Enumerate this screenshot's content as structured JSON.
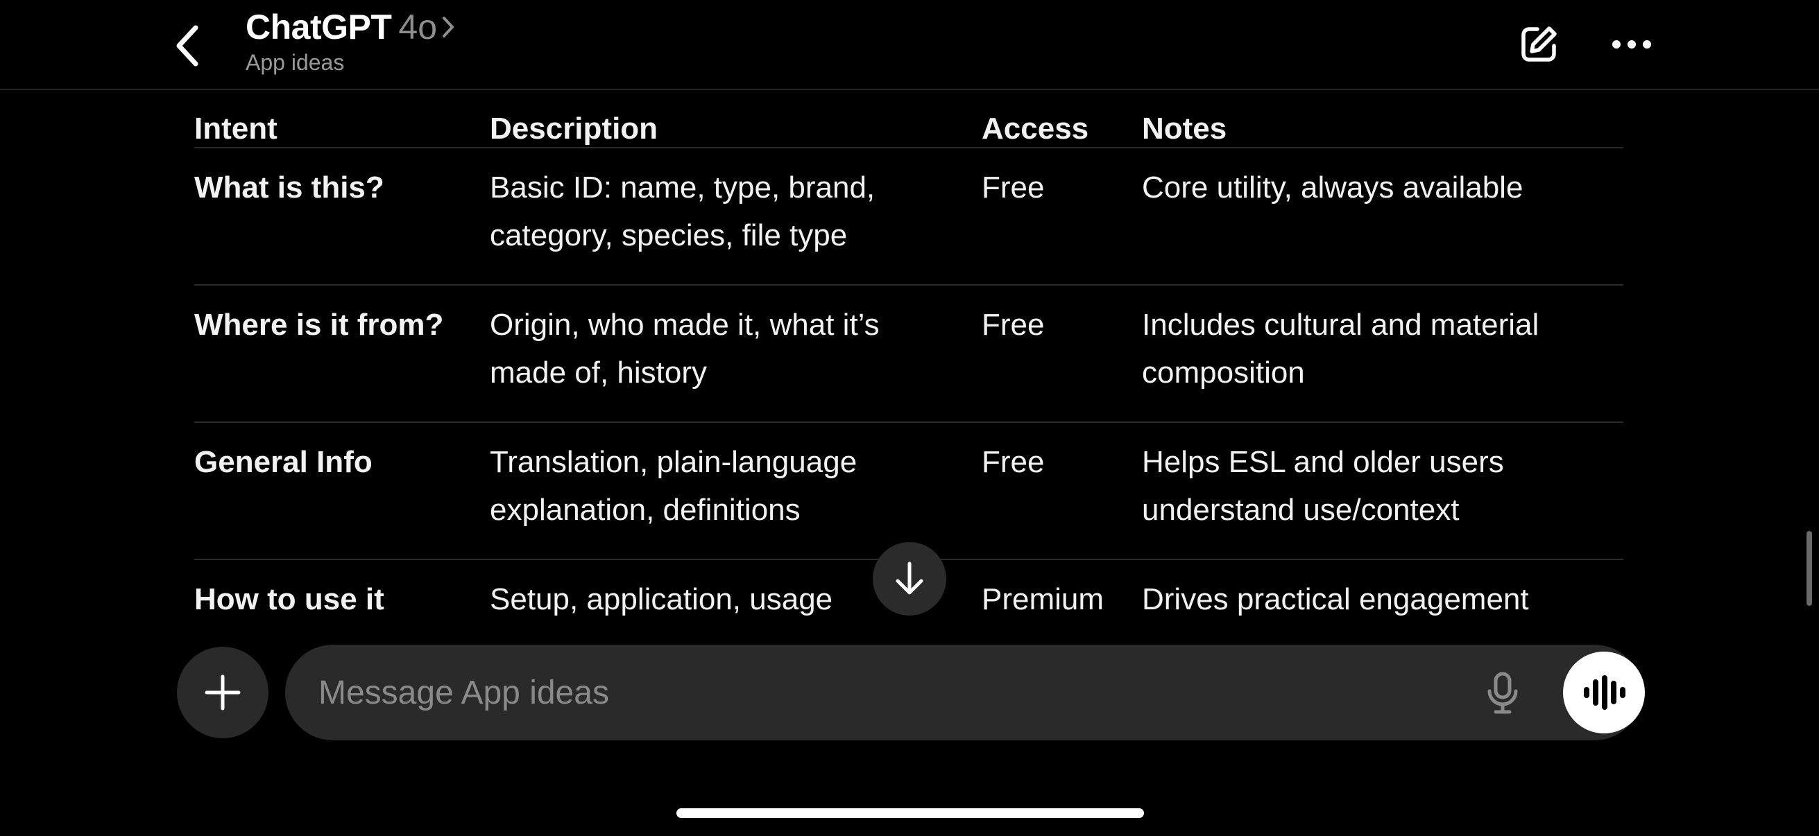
{
  "header": {
    "app_name": "ChatGPT",
    "model": "4o",
    "subtitle": "App ideas"
  },
  "table": {
    "columns": [
      "Intent",
      "Description",
      "Access",
      "Notes"
    ],
    "rows": [
      {
        "intent": "What is this?",
        "description": "Basic ID: name, type, brand, category, species, file type",
        "access": "Free",
        "notes": "Core utility, always available"
      },
      {
        "intent": "Where is it from?",
        "description": "Origin, who made it, what it’s made of, history",
        "access": "Free",
        "notes": "Includes cultural and material composition"
      },
      {
        "intent": "General Info",
        "description": "Translation, plain-language explanation, definitions",
        "access": "Free",
        "notes": "Helps ESL and older users understand use/context"
      },
      {
        "intent": "How to use it",
        "description": "Setup, application, usage",
        "access": "Premium",
        "notes": "Drives practical engagement"
      }
    ]
  },
  "composer": {
    "placeholder": "Message App ideas"
  },
  "icons": {
    "back": "chevron-left-icon",
    "model_chevron": "chevron-right-icon",
    "edit": "compose-icon",
    "more": "ellipsis-icon",
    "scroll_down": "arrow-down-icon",
    "plus": "plus-icon",
    "mic": "microphone-icon",
    "voice": "voice-waveform-icon"
  }
}
